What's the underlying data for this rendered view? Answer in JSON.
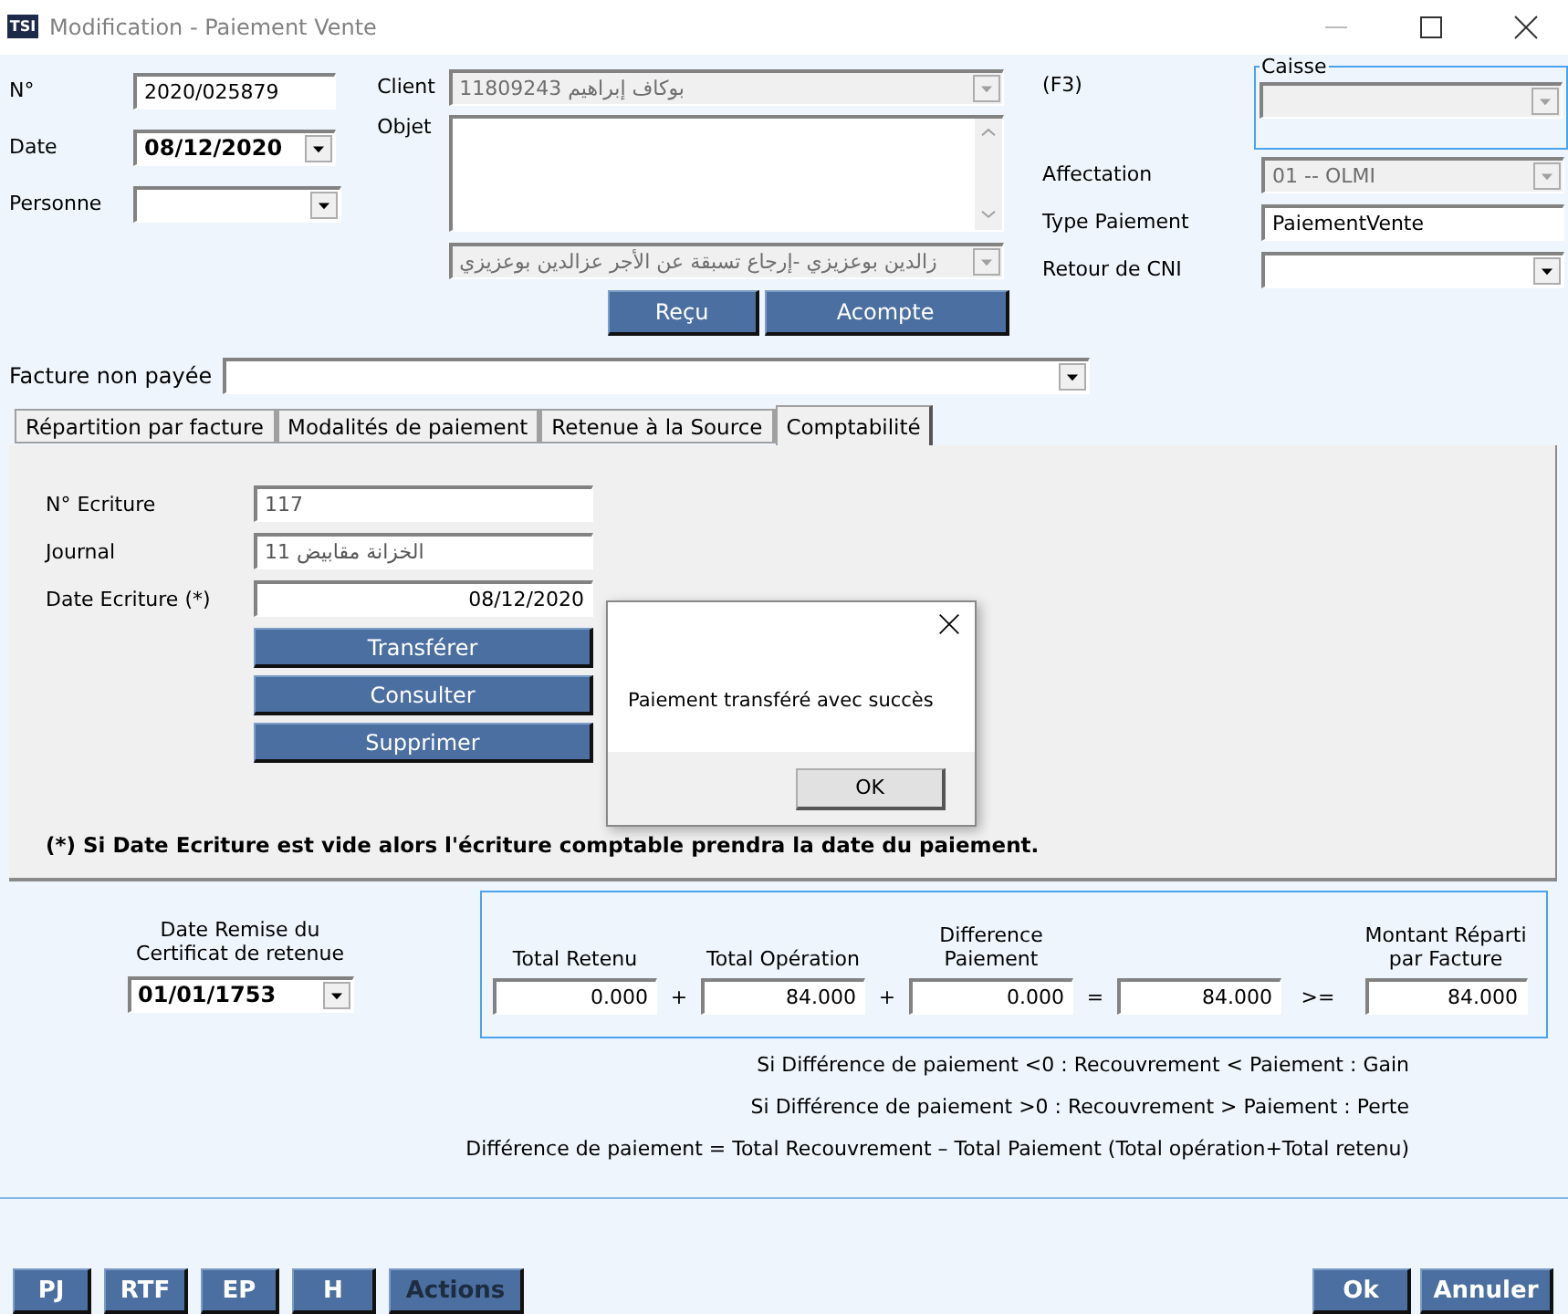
{
  "window": {
    "title": "Modification - Paiement Vente",
    "logo": "TSI"
  },
  "left_fields": [
    {
      "label": "N°",
      "value": "2020/025879",
      "kind": "text"
    },
    {
      "label": "Date",
      "value": "08/12/2020",
      "kind": "date"
    },
    {
      "label": "Personne",
      "kind": "combo"
    }
  ],
  "client": {
    "label": "Client",
    "value": "11809243 بوكاف إبراهيم",
    "shortcut": "(F3)",
    "disabled": true
  },
  "objet": {
    "label": "Objet",
    "combo_value": "زالدين بوعزيزي  -إرجاع تسبقة عن الأجر  عزالدين بوعزيزي"
  },
  "objet_buttons": [
    "Reçu",
    "Acompte"
  ],
  "caisse": {
    "legend": "Caisse",
    "disabled": true
  },
  "right_fields": [
    {
      "label": "Affectation",
      "value": "01 -- OLMI",
      "kind": "combo",
      "disabled": true
    },
    {
      "label": "Type Paiement",
      "value": "PaiementVente",
      "kind": "text",
      "disabled": false
    },
    {
      "label": "Retour de CNI",
      "kind": "combo",
      "disabled": false
    }
  ],
  "facture": {
    "label": "Facture non payée"
  },
  "tabs": [
    {
      "label": "Répartition par facture",
      "selected": false
    },
    {
      "label": "Modalités de paiement",
      "selected": false
    },
    {
      "label": "Retenue à la Source",
      "selected": false
    },
    {
      "label": "Comptabilité",
      "selected": true
    }
  ],
  "comptabilite": {
    "fields": [
      {
        "label": "N° Ecriture",
        "value": "117",
        "kind": "text"
      },
      {
        "label": "Journal",
        "value": "11  الخزانة مقابيض",
        "kind": "text"
      },
      {
        "label": "Date Ecriture (*)",
        "value": "08/12/2020",
        "kind": "date"
      }
    ],
    "buttons": [
      "Transférer",
      "Consulter",
      "Supprimer"
    ],
    "note": "(*) Si Date Ecriture est vide alors l'écriture comptable prendra la date du paiement."
  },
  "dialog": {
    "message": "Paiement transféré avec succès",
    "button": "OK"
  },
  "date_remise": {
    "label": "Date Remise du Certificat de retenue",
    "value": "01/01/1753"
  },
  "totals": [
    {
      "label": "Total Retenu",
      "value": "0.000",
      "operator": "+"
    },
    {
      "label": "Total Opération",
      "value": "84.000",
      "operator": "+"
    },
    {
      "label": "Difference Paiement",
      "value": "0.000",
      "operator": "="
    },
    {
      "value": "84.000",
      "operator": ">="
    },
    {
      "label": "Montant Réparti par Facture",
      "value": "84.000"
    }
  ],
  "notes": [
    "Si Différence de paiement <0 : Recouvrement < Paiement : Gain",
    "Si Différence de paiement >0 : Recouvrement > Paiement : Perte",
    "Différence de paiement = Total Recouvrement – Total Paiement (Total opération+Total retenu)"
  ],
  "footer_left": [
    {
      "label": "PJ",
      "disabled": false
    },
    {
      "label": "RTF",
      "disabled": false
    },
    {
      "label": "EP",
      "disabled": false
    },
    {
      "label": "H",
      "disabled": false
    },
    {
      "label": "Actions",
      "disabled": true
    }
  ],
  "footer_right": [
    {
      "label": "Ok",
      "disabled": false
    },
    {
      "label": "Annuler",
      "disabled": false
    }
  ]
}
